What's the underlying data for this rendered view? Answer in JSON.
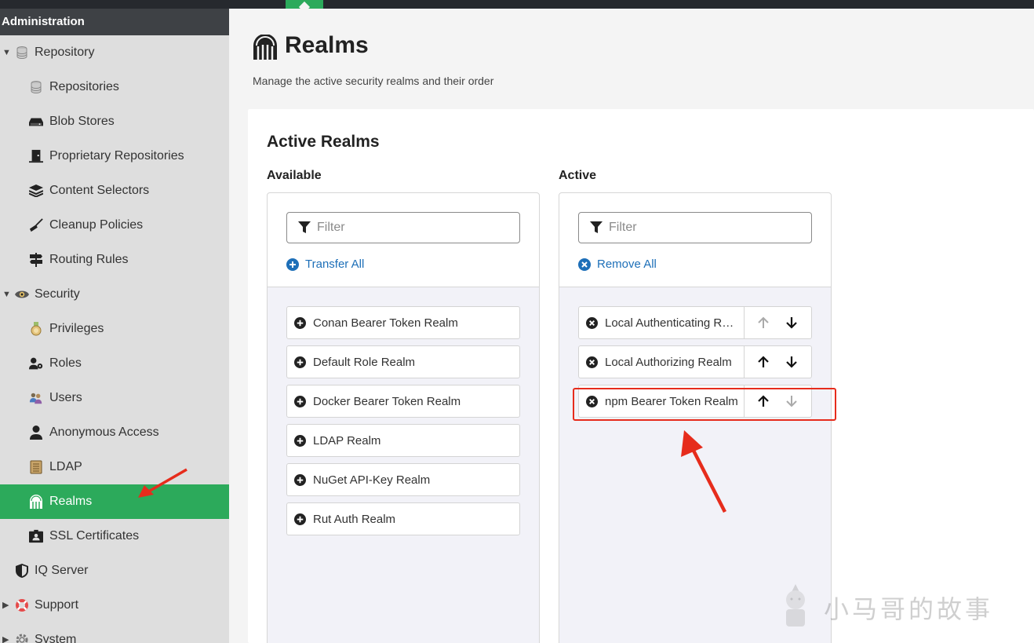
{
  "topbar": {
    "breadcrumb": ""
  },
  "sidebar": {
    "header": "Administration",
    "items": [
      {
        "label": "Repository",
        "icon": "database-icon",
        "level": 0,
        "expanded": true
      },
      {
        "label": "Repositories",
        "icon": "database-icon",
        "level": 1
      },
      {
        "label": "Blob Stores",
        "icon": "hdd-icon",
        "level": 1
      },
      {
        "label": "Proprietary Repositories",
        "icon": "door-icon",
        "level": 1
      },
      {
        "label": "Content Selectors",
        "icon": "layers-icon",
        "level": 1
      },
      {
        "label": "Cleanup Policies",
        "icon": "broom-icon",
        "level": 1
      },
      {
        "label": "Routing Rules",
        "icon": "signpost-icon",
        "level": 1
      },
      {
        "label": "Security",
        "icon": "eye-icon",
        "level": 0,
        "expanded": true
      },
      {
        "label": "Privileges",
        "icon": "medal-icon",
        "level": 1
      },
      {
        "label": "Roles",
        "icon": "user-gear-icon",
        "level": 1
      },
      {
        "label": "Users",
        "icon": "users-icon",
        "level": 1
      },
      {
        "label": "Anonymous Access",
        "icon": "user-icon",
        "level": 1
      },
      {
        "label": "LDAP",
        "icon": "book-icon",
        "level": 1
      },
      {
        "label": "Realms",
        "icon": "realm-gate-icon",
        "level": 1,
        "active": true
      },
      {
        "label": "SSL Certificates",
        "icon": "id-card-icon",
        "level": 1
      },
      {
        "label": "IQ Server",
        "icon": "shield-icon",
        "level": 0
      },
      {
        "label": "Support",
        "icon": "lifebuoy-icon",
        "level": 0,
        "collapsed": true
      },
      {
        "label": "System",
        "icon": "gear-icon",
        "level": 0,
        "collapsed": true
      }
    ]
  },
  "page": {
    "title": "Realms",
    "subtitle": "Manage the active security realms and their order"
  },
  "card": {
    "title": "Active Realms",
    "available": {
      "label": "Available",
      "filter_placeholder": "Filter",
      "action": "Transfer All",
      "items": [
        "Conan Bearer Token Realm",
        "Default Role Realm",
        "Docker Bearer Token Realm",
        "LDAP Realm",
        "NuGet API-Key Realm",
        "Rut Auth Realm"
      ]
    },
    "active": {
      "label": "Active",
      "filter_placeholder": "Filter",
      "action": "Remove All",
      "items": [
        {
          "label": "Local Authenticating Realm",
          "up_enabled": false,
          "down_enabled": true
        },
        {
          "label": "Local Authorizing Realm",
          "up_enabled": true,
          "down_enabled": true
        },
        {
          "label": "npm Bearer Token Realm",
          "up_enabled": true,
          "down_enabled": false
        }
      ]
    }
  },
  "watermark": "小马哥的故事",
  "colors": {
    "accent_green": "#2caa5b",
    "link_blue": "#1d6fb8",
    "annotation_red": "#e62c1c",
    "sidebar_bg": "#dedede",
    "sidebar_header_bg": "#3e4145"
  }
}
